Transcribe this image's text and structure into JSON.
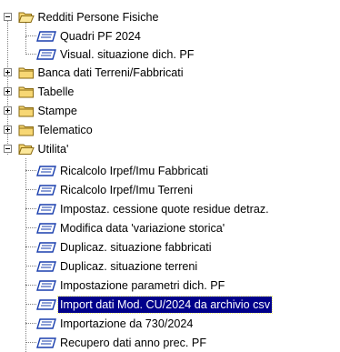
{
  "tree": {
    "root": {
      "label": "Redditi Persone Fisiche",
      "icon": "folder-open-icon",
      "expanded": true
    },
    "level1": [
      {
        "label": "Quadri PF 2024",
        "icon": "form-icon",
        "type": "leaf"
      },
      {
        "label": "Visual. situazione dich. PF",
        "icon": "form-icon",
        "type": "leaf"
      },
      {
        "label": "Banca dati Terreni/Fabbricati",
        "icon": "folder-icon",
        "type": "folder",
        "expanded": false
      },
      {
        "label": "Tabelle",
        "icon": "folder-icon",
        "type": "folder",
        "expanded": false
      },
      {
        "label": "Stampe",
        "icon": "folder-icon",
        "type": "folder",
        "expanded": false
      },
      {
        "label": "Telematico",
        "icon": "folder-icon",
        "type": "folder",
        "expanded": false
      },
      {
        "label": "Utilita'",
        "icon": "folder-open-icon",
        "type": "folder",
        "expanded": true
      }
    ],
    "utilita_items": [
      {
        "label": "Ricalcolo Irpef/Imu Fabbricati",
        "icon": "form-icon",
        "selected": false
      },
      {
        "label": "Ricalcolo Irpef/Imu Terreni",
        "icon": "form-icon",
        "selected": false
      },
      {
        "label": "Impostaz. cessione quote residue detraz.",
        "icon": "form-icon",
        "selected": false
      },
      {
        "label": "Modifica data 'variazione storica'",
        "icon": "form-icon",
        "selected": false
      },
      {
        "label": "Duplicaz. situazione fabbricati",
        "icon": "form-icon",
        "selected": false
      },
      {
        "label": "Duplicaz. situazione terreni",
        "icon": "form-icon",
        "selected": false
      },
      {
        "label": "Impostazione parametri dich. PF",
        "icon": "form-icon",
        "selected": false
      },
      {
        "label": "Import dati Mod. CU/2024 da archivio csv",
        "icon": "form-icon",
        "selected": true
      },
      {
        "label": "Importazione da 730/2024",
        "icon": "form-icon",
        "selected": false
      },
      {
        "label": "Recupero dati anno prec. PF",
        "icon": "form-icon",
        "selected": false
      }
    ],
    "colors": {
      "selection_bg": "#00008b",
      "selection_fg": "#ffffff",
      "folder": "#f2c94c",
      "form_icon": "#1a3fae"
    }
  }
}
